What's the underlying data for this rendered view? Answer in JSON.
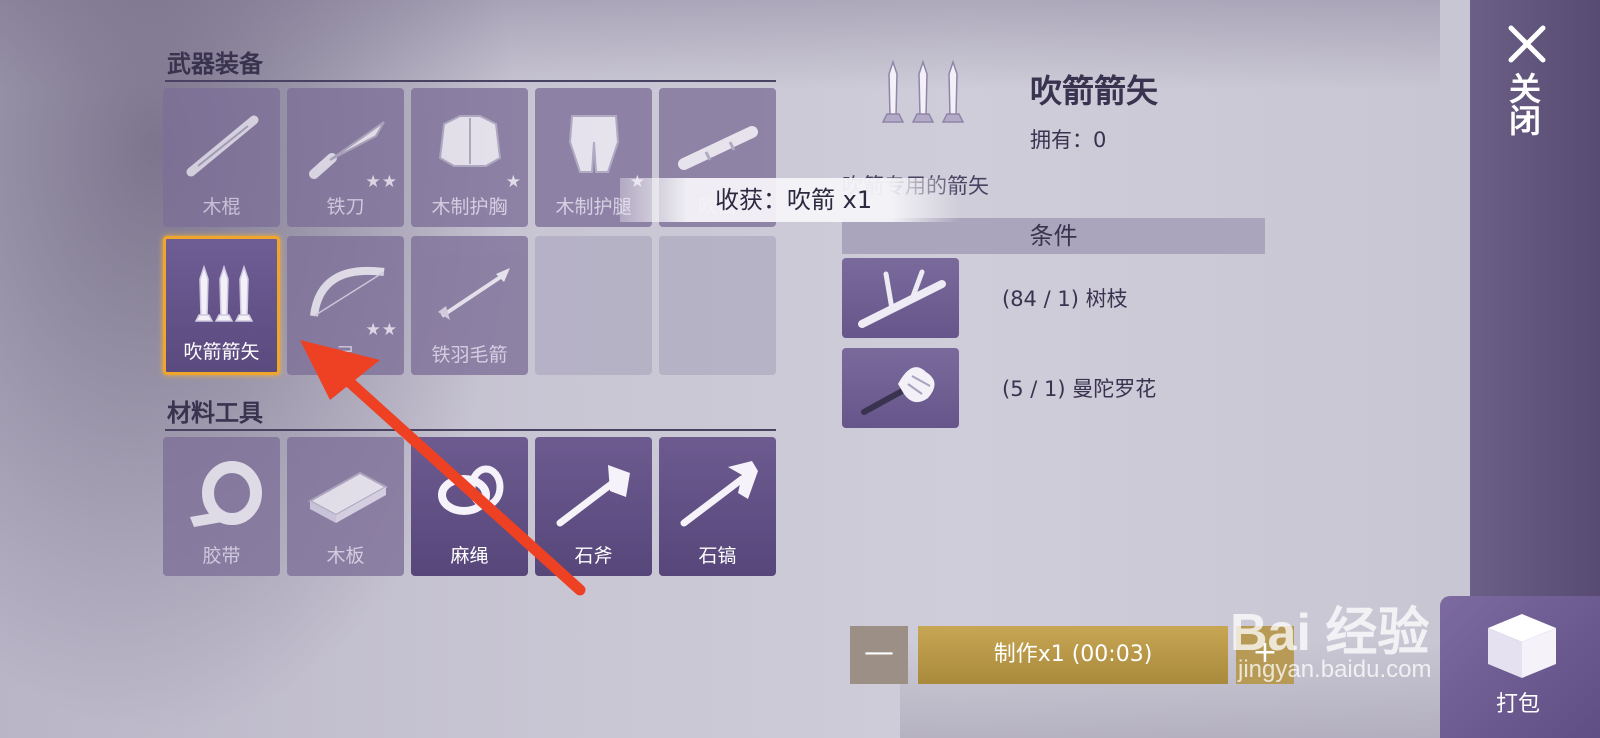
{
  "sections": {
    "weapons_title": "武器装备",
    "materials_title": "材料工具"
  },
  "weapon_items": [
    {
      "name": "木棍",
      "stars": "",
      "state": "dim",
      "icon": "stick-icon"
    },
    {
      "name": "铁刀",
      "stars": "★★",
      "state": "dim",
      "icon": "knife-icon"
    },
    {
      "name": "木制护胸",
      "stars": "★",
      "state": "dim",
      "icon": "chest-armor-icon"
    },
    {
      "name": "木制护腿",
      "stars": "★",
      "state": "dim",
      "icon": "leg-armor-icon"
    },
    {
      "name": "吹筒",
      "stars": "",
      "state": "dim",
      "icon": "blowpipe-icon"
    },
    {
      "name": "吹箭箭矢",
      "stars": "",
      "state": "selected",
      "icon": "darts-icon"
    },
    {
      "name": "弓",
      "stars": "★★",
      "state": "dim",
      "icon": "bow-icon"
    },
    {
      "name": "铁羽毛箭",
      "stars": "",
      "state": "dim",
      "icon": "arrow-icon"
    }
  ],
  "material_items": [
    {
      "name": "胶带",
      "state": "dim",
      "icon": "tape-icon"
    },
    {
      "name": "木板",
      "state": "dim",
      "icon": "plank-icon"
    },
    {
      "name": "麻绳",
      "state": "bright",
      "icon": "rope-icon"
    },
    {
      "name": "石斧",
      "state": "bright",
      "icon": "stone-axe-icon"
    },
    {
      "name": "石镐",
      "state": "bright",
      "icon": "stone-pickaxe-icon"
    }
  ],
  "detail": {
    "name": "吹箭箭矢",
    "own_label": "拥有：",
    "own_count": "0",
    "description": "吹箭专用的箭矢",
    "conditions_title": "条件"
  },
  "requirements": [
    {
      "have": "84",
      "need": "1",
      "label": "(84 / 1) 树枝",
      "icon": "branch-icon"
    },
    {
      "have": "5",
      "need": "1",
      "label": "(5 / 1) 曼陀罗花",
      "icon": "datura-flower-icon"
    }
  ],
  "toast": {
    "text": "收获：吹箭 x1"
  },
  "controls": {
    "minus": "—",
    "craft": "制作x1 (00:03)",
    "plus": "+",
    "close": "关闭",
    "pack": "打包"
  },
  "watermark": {
    "logo": "Bai 经验",
    "url": "jingyan.baidu.com"
  },
  "colors": {
    "selected_border": "#f0a52b",
    "craft_button": "#c7a654",
    "panel": "#6b5f86"
  }
}
